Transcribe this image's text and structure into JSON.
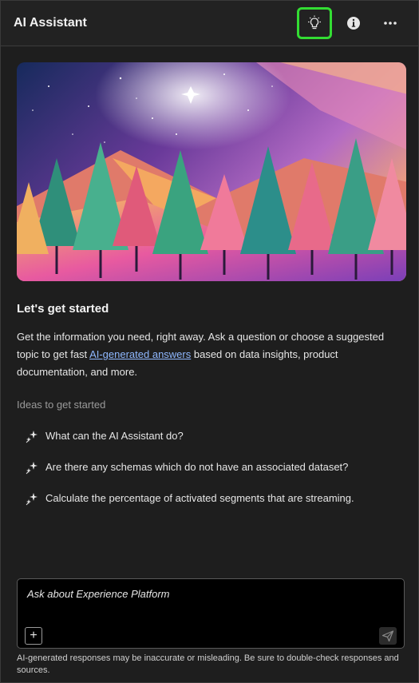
{
  "header": {
    "title": "AI Assistant",
    "icons": [
      "lightbulb-icon",
      "info-icon",
      "more-icon"
    ]
  },
  "hero": {
    "image": "low-poly forest illustration with star"
  },
  "welcome": {
    "heading": "Let's get started",
    "intro_before": "Get the information you need, right away. Ask a question or choose a suggested topic to get fast ",
    "intro_link": "AI-generated answers",
    "intro_after": " based on data insights, product documentation, and more."
  },
  "ideas": {
    "label": "Ideas to get started",
    "items": [
      "What can the AI Assistant do?",
      "Are there any schemas which do not have an associated dataset?",
      "Calculate the percentage of activated segments that are streaming."
    ]
  },
  "composer": {
    "placeholder": "Ask about Experience Platform",
    "add_label": "+"
  },
  "disclaimer": "AI-generated responses may be inaccurate or misleading. Be sure to double-check responses and sources.",
  "colors": {
    "active_outline": "#33dd33",
    "link": "#8fb8ff"
  }
}
